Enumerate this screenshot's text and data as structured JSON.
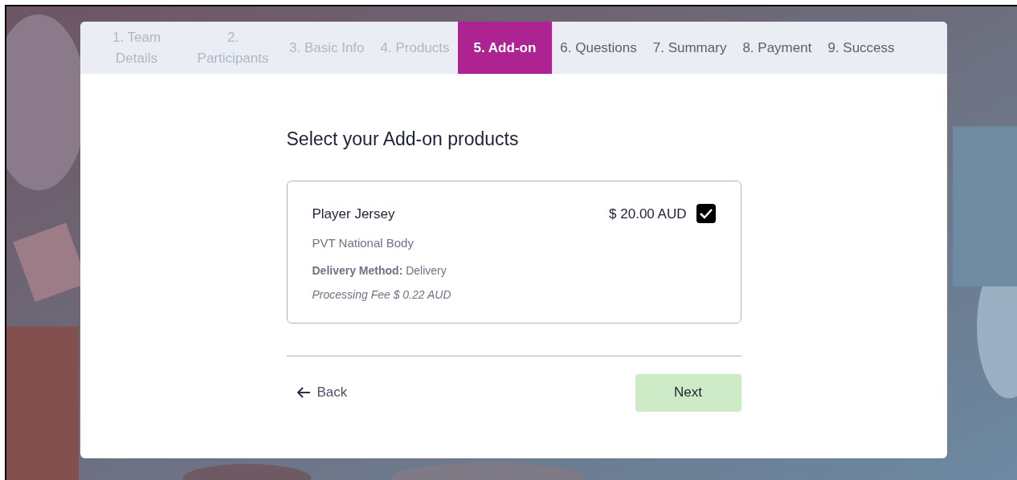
{
  "steps": [
    {
      "label": "1. Team Details",
      "completed": true,
      "selected": false
    },
    {
      "label": "2. Participants",
      "completed": true,
      "selected": false
    },
    {
      "label": "3. Basic Info",
      "completed": true,
      "selected": false
    },
    {
      "label": "4. Products",
      "completed": true,
      "selected": false
    },
    {
      "label": "5. Add-on",
      "completed": false,
      "selected": true
    },
    {
      "label": "6. Questions",
      "completed": false,
      "selected": false
    },
    {
      "label": "7. Summary",
      "completed": false,
      "selected": false
    },
    {
      "label": "8. Payment",
      "completed": false,
      "selected": false
    },
    {
      "label": "9. Success",
      "completed": false,
      "selected": false
    }
  ],
  "heading": "Select your Add-on products",
  "products": [
    {
      "name": "Player Jersey",
      "price": "$ 20.00 AUD",
      "checked": true,
      "organisation": "PVT National Body",
      "delivery": "**Delivery Method:** Delivery",
      "fee": "Processing Fee $ 0.22 AUD"
    }
  ],
  "back_button": "Back",
  "next_button": {
    "label": "Next",
    "disabled": true
  }
}
